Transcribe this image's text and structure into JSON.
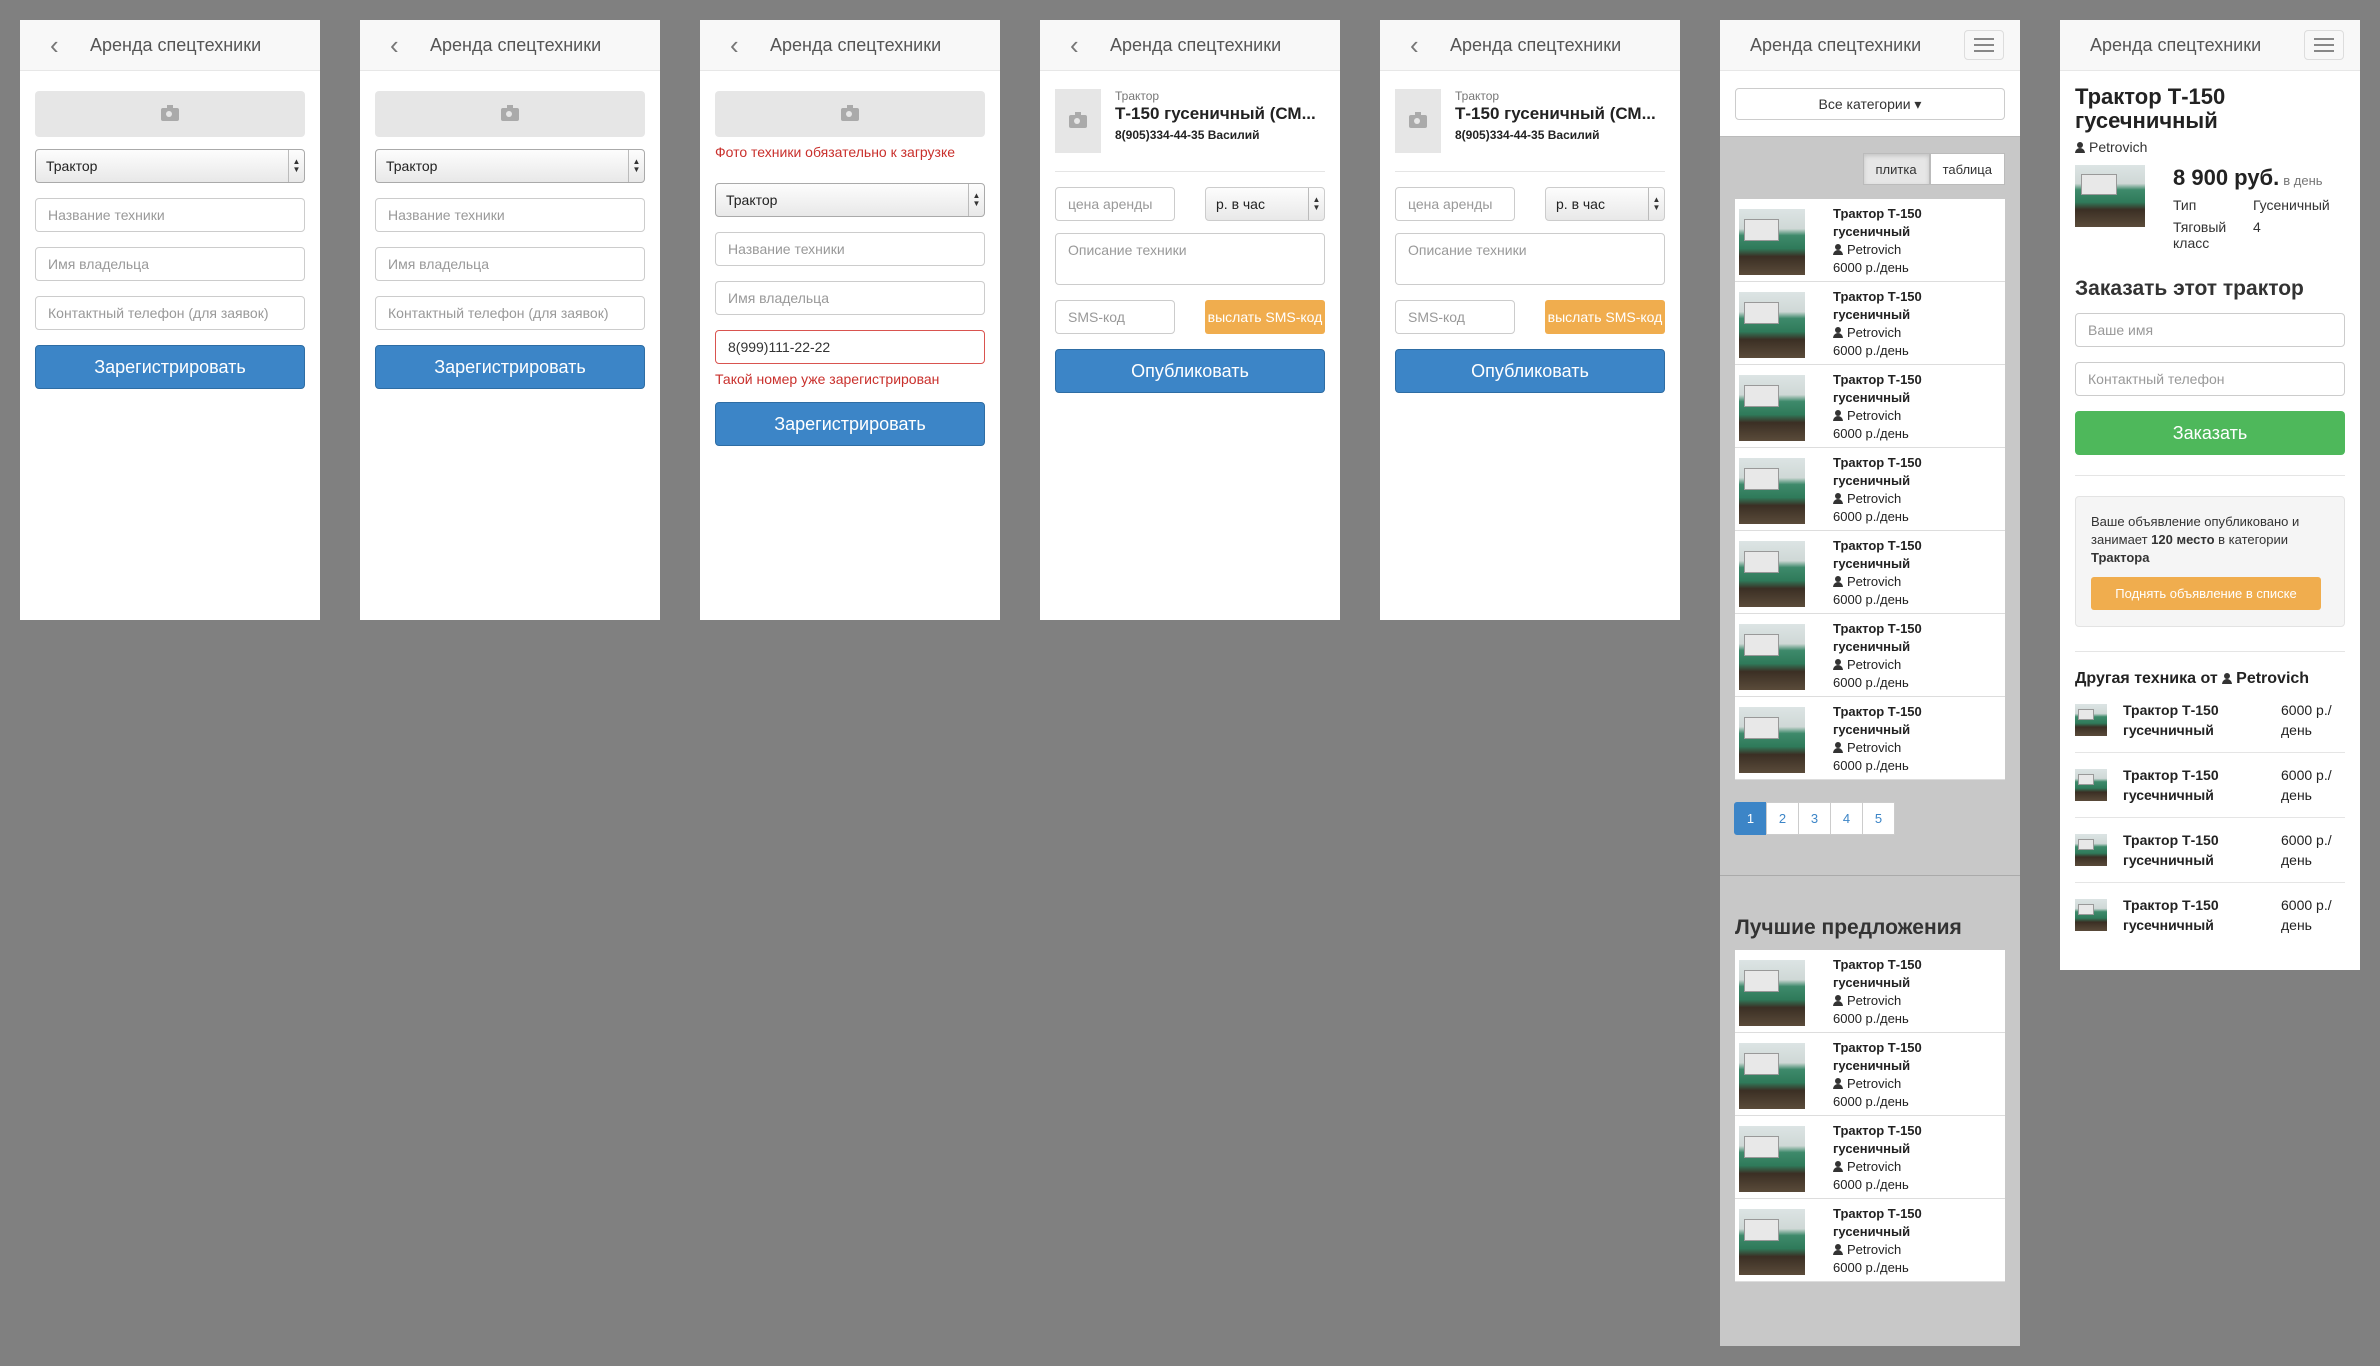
{
  "app_title": "Аренда спецтехники",
  "form": {
    "category": "Трактор",
    "name_placeholder": "Название техники",
    "owner_placeholder": "Имя владельца",
    "phone_placeholder": "Контактный телефон (для заявок)",
    "phone_value": "8(999)111-22-22",
    "submit": "Зарегистрировать",
    "photo_error": "Фото техники обязательно к загрузке",
    "phone_error": "Такой номер уже зарегистрирован"
  },
  "publish": {
    "item_category": "Трактор",
    "item_name": "Т-150 гусеничный (СМ...",
    "item_contact": "8(905)334-44-35 Василий",
    "price_placeholder": "цена аренды",
    "unit": "р. в час",
    "description_placeholder": "Описание техники",
    "sms_placeholder": "SMS-код",
    "send_sms": "выслать SMS-код",
    "publish_button": "Опубликовать"
  },
  "catalog": {
    "all_categories": "Все категории",
    "view_tile": "плитка",
    "view_table": "таблица",
    "item": {
      "title1": "Трактор Т-150",
      "title2": "гусеничный",
      "owner": "Petrovich",
      "price": "6000 р./день"
    },
    "pages": [
      "1",
      "2",
      "3",
      "4",
      "5"
    ],
    "best_title": "Лучшие предложения"
  },
  "detail": {
    "title": "Трактор Т-150 гусечничный",
    "owner": "Petrovich",
    "price": "8 900 руб.",
    "price_unit": "в день",
    "type_label": "Тип",
    "type_value": "Гусеничный",
    "class_label": "Тяговый класс",
    "class_value": "4",
    "order_title": "Заказать этот трактор",
    "name_placeholder": "Ваше имя",
    "phone_placeholder": "Контактный телефон",
    "order_button": "Заказать",
    "notice_text1": "Ваше объявление опубликовано и занимает ",
    "notice_rank": "120 место",
    "notice_text2": " в категории ",
    "notice_category": "Трактора",
    "boost_button": "Поднять объявление в списке",
    "other_title": "Другая техника от",
    "other_owner": "Petrovich",
    "other_item": {
      "name": "Трактор Т-150 гусечничный",
      "price": "6000 р./ день"
    }
  }
}
